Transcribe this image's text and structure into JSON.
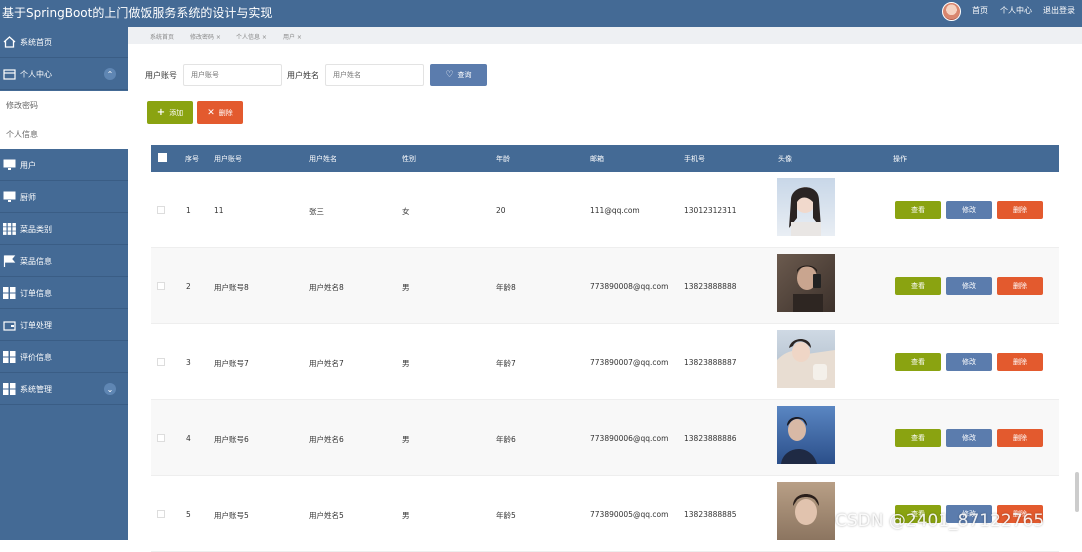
{
  "header": {
    "title": "基于SpringBoot的上门做饭服务系统的设计与实现",
    "links": [
      "首页",
      "个人中心",
      "退出登录"
    ]
  },
  "sidebar": {
    "items": [
      {
        "label": "系统首页",
        "icon": "home-icon"
      },
      {
        "label": "个人中心",
        "icon": "wallet-icon"
      },
      {
        "label": "修改密码"
      },
      {
        "label": "个人信息"
      },
      {
        "label": "用户",
        "icon": "monitor-icon"
      },
      {
        "label": "厨师",
        "icon": "monitor-icon"
      },
      {
        "label": "菜品类别",
        "icon": "grid-icon"
      },
      {
        "label": "菜品信息",
        "icon": "flag-icon"
      },
      {
        "label": "订单信息",
        "icon": "grid-icon"
      },
      {
        "label": "订单处理",
        "icon": "wallet-icon"
      },
      {
        "label": "评价信息",
        "icon": "grid-icon"
      },
      {
        "label": "系统管理",
        "icon": "grid-icon"
      }
    ]
  },
  "tabs": [
    "系统首页",
    "修改密码 ×",
    "个人信息 ×",
    "用户 ×"
  ],
  "search": {
    "account_label": "用户账号",
    "account_placeholder": "用户账号",
    "name_label": "用户姓名",
    "name_placeholder": "用户姓名",
    "query_button": "查询"
  },
  "actions": {
    "add": "添加",
    "delete": "删除"
  },
  "table": {
    "columns": [
      "序号",
      "用户账号",
      "用户姓名",
      "性别",
      "年龄",
      "邮箱",
      "手机号",
      "头像",
      "操作"
    ],
    "rows": [
      {
        "index": "1",
        "account": "11",
        "name": "张三",
        "gender": "女",
        "age": "20",
        "email": "111@qq.com",
        "phone": "13012312311"
      },
      {
        "index": "2",
        "account": "用户账号8",
        "name": "用户姓名8",
        "gender": "男",
        "age": "年龄8",
        "email": "773890008@qq.com",
        "phone": "13823888888"
      },
      {
        "index": "3",
        "account": "用户账号7",
        "name": "用户姓名7",
        "gender": "男",
        "age": "年龄7",
        "email": "773890007@qq.com",
        "phone": "13823888887"
      },
      {
        "index": "4",
        "account": "用户账号6",
        "name": "用户姓名6",
        "gender": "男",
        "age": "年龄6",
        "email": "773890006@qq.com",
        "phone": "13823888886"
      },
      {
        "index": "5",
        "account": "用户账号5",
        "name": "用户姓名5",
        "gender": "男",
        "age": "年龄5",
        "email": "773890005@qq.com",
        "phone": "13823888885"
      }
    ],
    "row_buttons": {
      "view": "查看",
      "edit": "修改",
      "delete": "删除"
    }
  },
  "watermark": "CSDN @2401_87122765",
  "colors": {
    "primary": "#446a95",
    "view": "#8aa311",
    "edit": "#5b7cad",
    "delete": "#e35a2e"
  }
}
